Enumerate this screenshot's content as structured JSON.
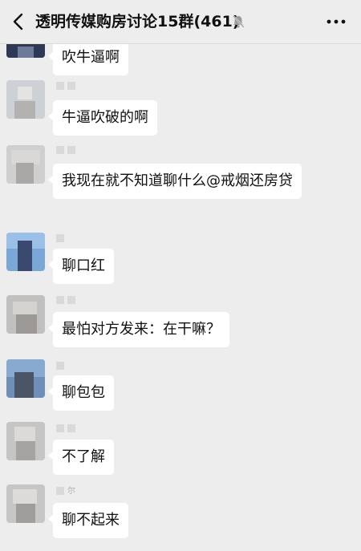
{
  "header": {
    "title": "透明传媒购房讨论15群(461)"
  },
  "messages": [
    {
      "text": "吹牛逼啊",
      "sender": ""
    },
    {
      "text": "牛逼吹破的啊",
      "sender": ""
    },
    {
      "text": "我现在就不知道聊什么@戒烟还房贷",
      "sender": ""
    },
    {
      "text": "聊口红",
      "sender": ""
    },
    {
      "text": "最怕对方发来：在干嘛？",
      "sender": ""
    },
    {
      "text": "聊包包",
      "sender": ""
    },
    {
      "text": "不了解",
      "sender": ""
    },
    {
      "text": "聊不起来",
      "sender": "尔"
    }
  ],
  "colors": {
    "background": "#ededed",
    "bubble": "#ffffff",
    "text": "#111111"
  },
  "icons": [
    "back-icon",
    "mute-icon",
    "more-icon"
  ]
}
